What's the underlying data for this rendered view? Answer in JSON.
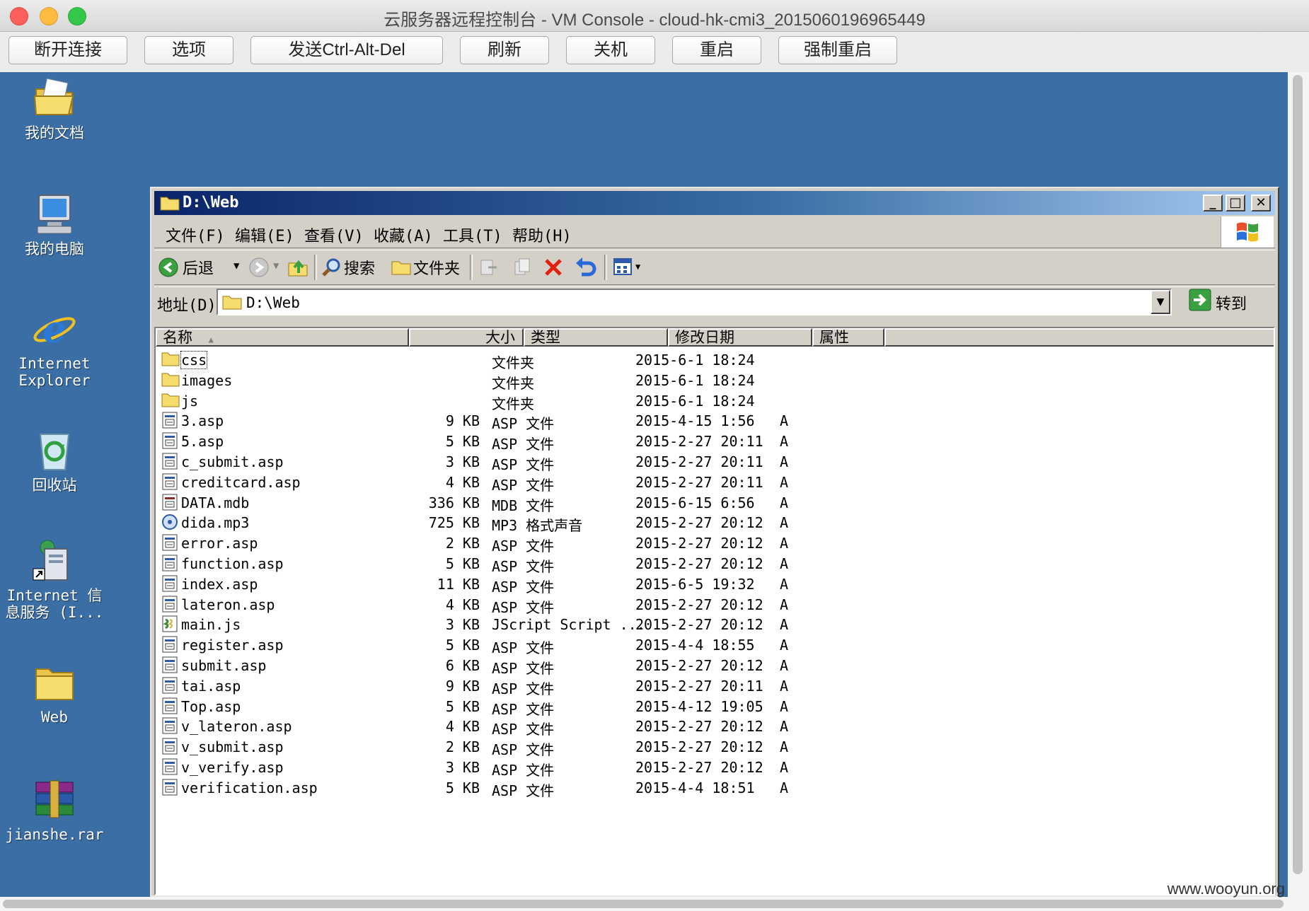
{
  "mac": {
    "title": "云服务器远程控制台 - VM Console - cloud-hk-cmi3_2015060196965449"
  },
  "console_toolbar": [
    "断开连接",
    "选项",
    "发送Ctrl-Alt-Del",
    "刷新",
    "关机",
    "重启",
    "强制重启"
  ],
  "desktop": {
    "background": "#3a6ea5",
    "icons": [
      {
        "label": "我的文档",
        "icon": "my-documents-icon"
      },
      {
        "label": "我的电脑",
        "icon": "my-computer-icon"
      },
      {
        "label_1": "Internet",
        "label_2": "Explorer",
        "icon": "internet-explorer-icon"
      },
      {
        "label": "回收站",
        "icon": "recycle-bin-icon"
      },
      {
        "label_1": "Internet 信",
        "label_2": "息服务 (I...",
        "icon": "iis-shortcut-icon"
      },
      {
        "label": "Web",
        "icon": "folder-icon"
      },
      {
        "label": "jianshe.rar",
        "icon": "winrar-archive-icon"
      }
    ]
  },
  "explorer": {
    "title": "D:\\Web",
    "menu": [
      "文件(F)",
      "编辑(E)",
      "查看(V)",
      "收藏(A)",
      "工具(T)",
      "帮助(H)"
    ],
    "toolbar": {
      "back": "后退",
      "search": "搜索",
      "folders": "文件夹"
    },
    "address": {
      "label": "地址(D)",
      "value": "D:\\Web",
      "go": "转到"
    },
    "columns": [
      "名称",
      "大小",
      "类型",
      "修改日期",
      "属性"
    ],
    "files": [
      {
        "name": "css",
        "size": "",
        "type": "文件夹",
        "date": "2015-6-1 18:24",
        "attr": "",
        "icon": "folder-icon"
      },
      {
        "name": "images",
        "size": "",
        "type": "文件夹",
        "date": "2015-6-1 18:24",
        "attr": "",
        "icon": "folder-icon"
      },
      {
        "name": "js",
        "size": "",
        "type": "文件夹",
        "date": "2015-6-1 18:24",
        "attr": "",
        "icon": "folder-icon"
      },
      {
        "name": "3.asp",
        "size": "9 KB",
        "type": "ASP 文件",
        "date": "2015-4-15 1:56",
        "attr": "A",
        "icon": "asp-file-icon"
      },
      {
        "name": "5.asp",
        "size": "5 KB",
        "type": "ASP 文件",
        "date": "2015-2-27 20:11",
        "attr": "A",
        "icon": "asp-file-icon"
      },
      {
        "name": "c_submit.asp",
        "size": "3 KB",
        "type": "ASP 文件",
        "date": "2015-2-27 20:11",
        "attr": "A",
        "icon": "asp-file-icon"
      },
      {
        "name": "creditcard.asp",
        "size": "4 KB",
        "type": "ASP 文件",
        "date": "2015-2-27 20:11",
        "attr": "A",
        "icon": "asp-file-icon"
      },
      {
        "name": "DATA.mdb",
        "size": "336 KB",
        "type": "MDB 文件",
        "date": "2015-6-15 6:56",
        "attr": "A",
        "icon": "mdb-file-icon"
      },
      {
        "name": "dida.mp3",
        "size": "725 KB",
        "type": "MP3 格式声音",
        "date": "2015-2-27 20:12",
        "attr": "A",
        "icon": "mp3-file-icon"
      },
      {
        "name": "error.asp",
        "size": "2 KB",
        "type": "ASP 文件",
        "date": "2015-2-27 20:12",
        "attr": "A",
        "icon": "asp-file-icon"
      },
      {
        "name": "function.asp",
        "size": "5 KB",
        "type": "ASP 文件",
        "date": "2015-2-27 20:12",
        "attr": "A",
        "icon": "asp-file-icon"
      },
      {
        "name": "index.asp",
        "size": "11 KB",
        "type": "ASP 文件",
        "date": "2015-6-5 19:32",
        "attr": "A",
        "icon": "asp-file-icon"
      },
      {
        "name": "lateron.asp",
        "size": "4 KB",
        "type": "ASP 文件",
        "date": "2015-2-27 20:12",
        "attr": "A",
        "icon": "asp-file-icon"
      },
      {
        "name": "main.js",
        "size": "3 KB",
        "type": "JScript Script ...",
        "date": "2015-2-27 20:12",
        "attr": "A",
        "icon": "js-file-icon"
      },
      {
        "name": "register.asp",
        "size": "5 KB",
        "type": "ASP 文件",
        "date": "2015-4-4 18:55",
        "attr": "A",
        "icon": "asp-file-icon"
      },
      {
        "name": "submit.asp",
        "size": "6 KB",
        "type": "ASP 文件",
        "date": "2015-2-27 20:12",
        "attr": "A",
        "icon": "asp-file-icon"
      },
      {
        "name": "tai.asp",
        "size": "9 KB",
        "type": "ASP 文件",
        "date": "2015-2-27 20:11",
        "attr": "A",
        "icon": "asp-file-icon"
      },
      {
        "name": "Top.asp",
        "size": "5 KB",
        "type": "ASP 文件",
        "date": "2015-4-12 19:05",
        "attr": "A",
        "icon": "asp-file-icon"
      },
      {
        "name": "v_lateron.asp",
        "size": "4 KB",
        "type": "ASP 文件",
        "date": "2015-2-27 20:12",
        "attr": "A",
        "icon": "asp-file-icon"
      },
      {
        "name": "v_submit.asp",
        "size": "2 KB",
        "type": "ASP 文件",
        "date": "2015-2-27 20:12",
        "attr": "A",
        "icon": "asp-file-icon"
      },
      {
        "name": "v_verify.asp",
        "size": "3 KB",
        "type": "ASP 文件",
        "date": "2015-2-27 20:12",
        "attr": "A",
        "icon": "asp-file-icon"
      },
      {
        "name": "verification.asp",
        "size": "5 KB",
        "type": "ASP 文件",
        "date": "2015-4-4 18:51",
        "attr": "A",
        "icon": "asp-file-icon"
      }
    ]
  },
  "watermark": "www.wooyun.org"
}
